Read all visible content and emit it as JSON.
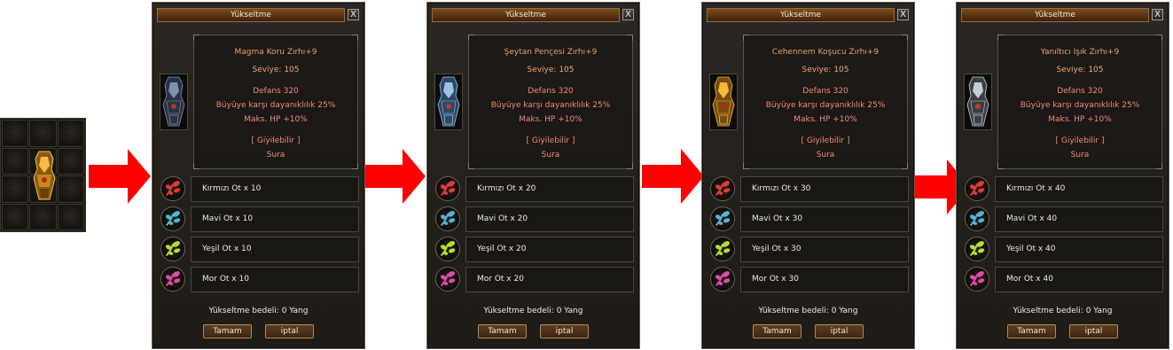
{
  "inventory": {
    "item_icon": "gold-armor-icon",
    "slot_count": 12
  },
  "panels": [
    {
      "title": "Yükseltme",
      "close_label": "X",
      "item_name": "Magma Koru Zırhı+9",
      "level": "Seviye: 105",
      "defense": "Defans 320",
      "magic_resist": "Büyüye karşı dayanıklılık 25%",
      "max_hp": "Maks. HP +10%",
      "wearable": "[ Giyilebilir ]",
      "class": "Sura",
      "armor_color": "dark",
      "materials": [
        "Kırmızı Ot x 10",
        "Mavi Ot x 10",
        "Yeşil Ot x 10",
        "Mor Ot x 10"
      ],
      "cost": "Yükseltme bedeli: 0 Yang",
      "ok_label": "Tamam",
      "cancel_label": "iptal"
    },
    {
      "title": "Yükseltme",
      "close_label": "X",
      "item_name": "Şeytan Pençesi Zırhı+9",
      "level": "Seviye: 105",
      "defense": "Defans 320",
      "magic_resist": "Büyüye karşı dayanıklılık 25%",
      "max_hp": "Maks. HP +10%",
      "wearable": "[ Giyilebilir ]",
      "class": "Sura",
      "armor_color": "blue",
      "materials": [
        "Kırmızı Ot x 20",
        "Mavi Ot x 20",
        "Yeşil Ot x 20",
        "Mor Ot x 20"
      ],
      "cost": "Yükseltme bedeli: 0 Yang",
      "ok_label": "Tamam",
      "cancel_label": "iptal"
    },
    {
      "title": "Yükseltme",
      "close_label": "X",
      "item_name": "Cehennem Koşucu Zırhı+9",
      "level": "Seviye: 105",
      "defense": "Defans 320",
      "magic_resist": "Büyüye karşı dayanıklılık 25%",
      "max_hp": "Maks. HP +10%",
      "wearable": "[ Giyilebilir ]",
      "class": "Sura",
      "armor_color": "gold",
      "materials": [
        "Kırmızı Ot x 30",
        "Mavi Ot x 30",
        "Yeşil Ot x 30",
        "Mor Ot x 30"
      ],
      "cost": "Yükseltme bedeli: 0 Yang",
      "ok_label": "Tamam",
      "cancel_label": "iptal"
    },
    {
      "title": "Yükseltme",
      "close_label": "X",
      "item_name": "Yanıltıcı Işık Zırhı+9",
      "level": "Seviye: 105",
      "defense": "Defans 320",
      "magic_resist": "Büyüye karşı dayanıklılık 25%",
      "max_hp": "Maks. HP +10%",
      "wearable": "[ Giyilebilir ]",
      "class": "Sura",
      "armor_color": "silver",
      "materials": [
        "Kırmızı Ot x 40",
        "Mavi Ot x 40",
        "Yeşil Ot x 40",
        "Mor Ot x 40"
      ],
      "cost": "Yükseltme bedeli: 0 Yang",
      "ok_label": "Tamam",
      "cancel_label": "iptal"
    }
  ],
  "herb_colors": [
    "#e23a3a",
    "#4fb6d6",
    "#b6e02e",
    "#e04aa8"
  ],
  "herb_icons": [
    "red-herb-icon",
    "blue-herb-icon",
    "green-herb-icon",
    "purple-herb-icon"
  ],
  "armor_palette": {
    "dark": {
      "base": "#2a3142",
      "hi": "#7f8fae",
      "accent": "#b2342b"
    },
    "blue": {
      "base": "#2c4a66",
      "hi": "#9cc3e6",
      "accent": "#c23a2c"
    },
    "gold": {
      "base": "#7a4a12",
      "hi": "#f2b93a",
      "accent": "#b62a18"
    },
    "silver": {
      "base": "#3c3f46",
      "hi": "#c7ccd4",
      "accent": "#c23a2c"
    }
  },
  "arrow_color": "#ff0000"
}
